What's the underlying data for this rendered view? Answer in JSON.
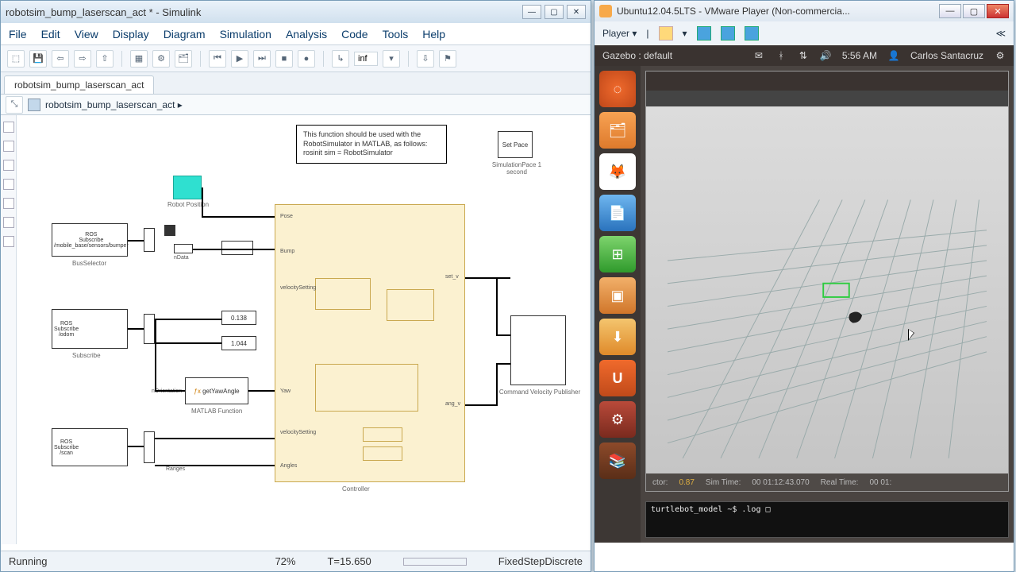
{
  "simulink": {
    "title": "robotsim_bump_laserscan_act * - Simulink",
    "menus": [
      "File",
      "Edit",
      "View",
      "Display",
      "Diagram",
      "Simulation",
      "Analysis",
      "Code",
      "Tools",
      "Help"
    ],
    "stop_time": "inf",
    "tab": "robotsim_bump_laserscan_act",
    "breadcrumb": "robotsim_bump_laserscan_act ▸",
    "annotation": "This function should be used with the\nRobotSimulator in MATLAB, as follows:\n\nrosinit\nsim = RobotSimulator",
    "simpace_label": "SimulationPace\n1 second",
    "set_pace": "Set\nPace",
    "robot_pos_label": "Robot Position",
    "controller_label": "Controller",
    "matlab_fcn_label": "MATLAB Function",
    "cmdvel_label": "Command Velocity Publisher",
    "sub_label": "Subscribe",
    "bus_label": "BusSelector",
    "terminator": "Terminator",
    "ports": {
      "pose": "Pose",
      "bump": "Bump",
      "data": "nData",
      "vel": "velocitySetting",
      "vel2": "velocitySetting",
      "yaw": "Yaw",
      "angles": "Angles",
      "ranges": "Ranges",
      "set": "set_v",
      "ang": "ang_v",
      "orientation": "nOrientation",
      "gety": "getYawAngle"
    },
    "status": {
      "state": "Running",
      "progress": "72%",
      "time": "T=15.650",
      "solver": "FixedStepDiscrete"
    }
  },
  "vmware": {
    "title": "Ubuntu12.04.5LTS - VMware Player (Non-commercia...",
    "player": "Player",
    "top": {
      "app": "Gazebo : default",
      "time": "5:56 AM",
      "user": "Carlos Santacruz"
    },
    "gaz_status": {
      "factor_label": "ctor:",
      "factor": "0.87",
      "sim_label": "Sim Time:",
      "sim": "00 01:12:43.070",
      "real_label": "Real Time:",
      "real": "00 01:"
    },
    "terminal": "turtlebot_model ~$ .log\n□"
  }
}
